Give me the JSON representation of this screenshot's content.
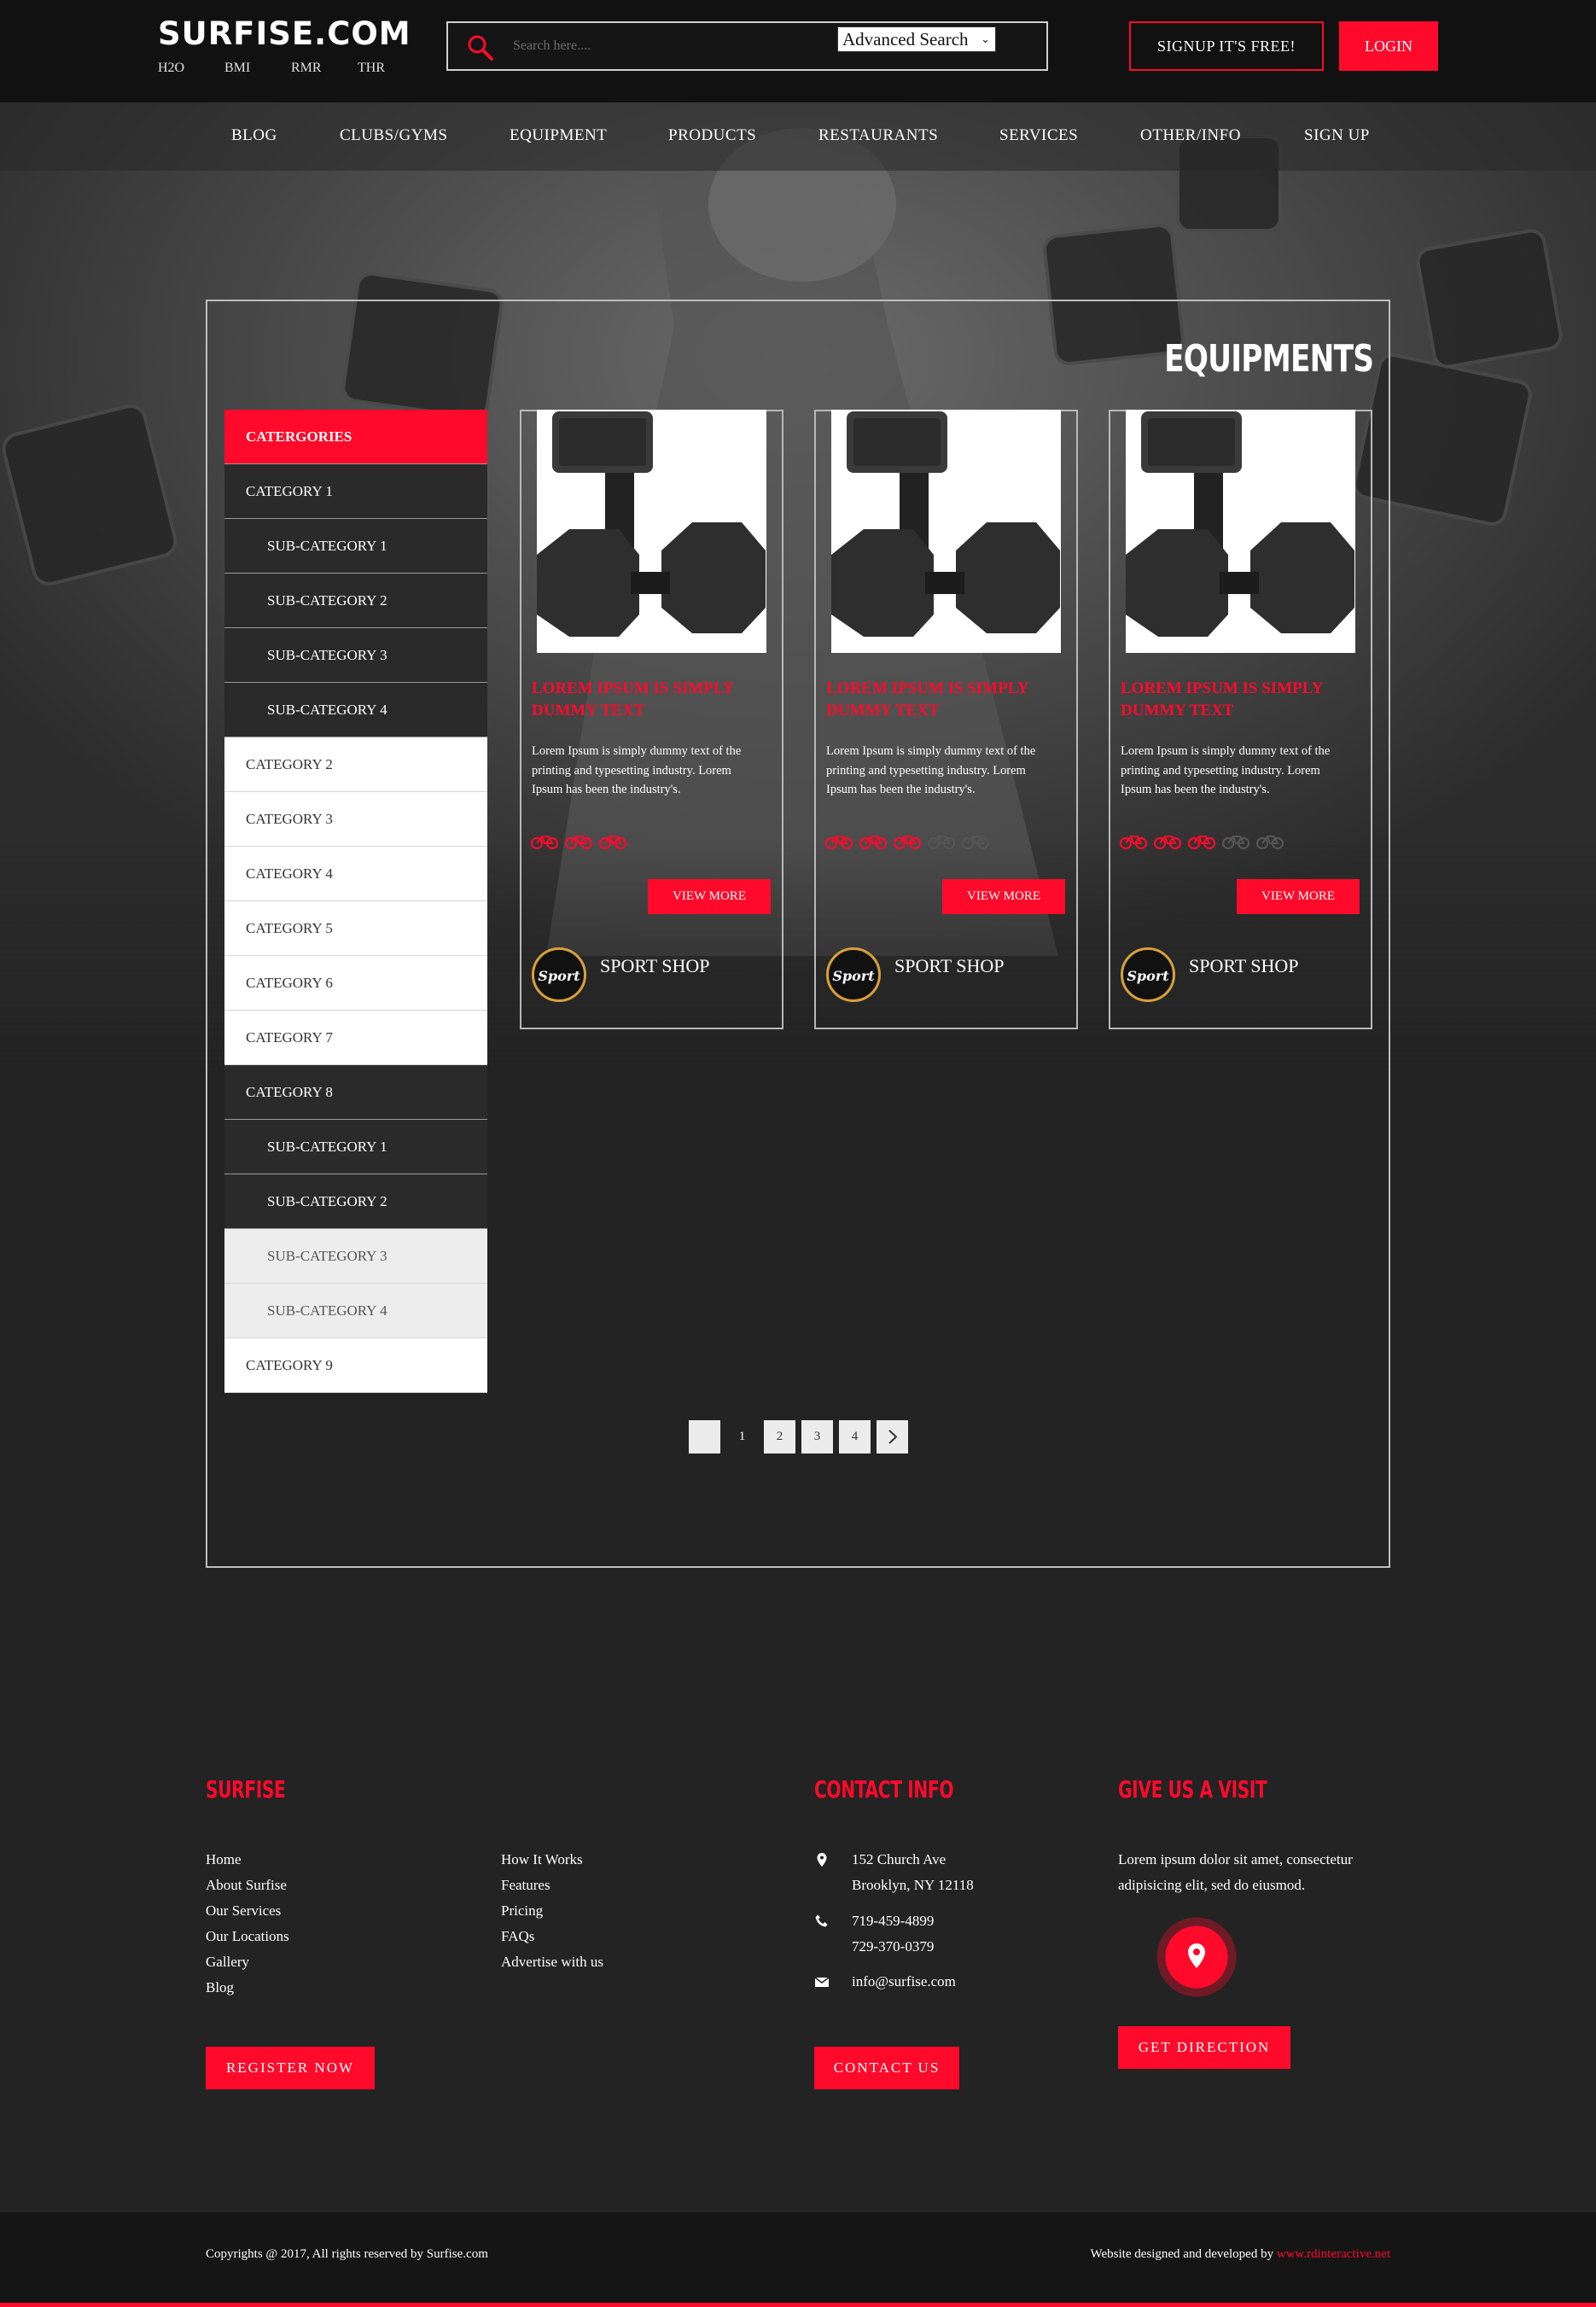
{
  "header": {
    "logo": "SURFISE.COM",
    "logo_links": [
      "H2O",
      "BMI",
      "RMR",
      "THR"
    ],
    "search_placeholder": "Search here....",
    "advanced_search": "Advanced Search",
    "signup": "SIGNUP IT'S FREE!",
    "login": "LOGIN"
  },
  "nav": [
    "BLOG",
    "CLUBS/GYMS",
    "EQUIPMENT",
    "PRODUCTS",
    "RESTAURANTS",
    "SERVICES",
    "OTHER/INFO",
    "SIGN UP"
  ],
  "page_title": "EQUIPMENTS",
  "sidebar": {
    "heading": "CATERGORIES",
    "items": [
      {
        "label": "CATEGORY 1",
        "style": "dark",
        "sub": false
      },
      {
        "label": "SUB-CATEGORY 1",
        "style": "dark",
        "sub": true
      },
      {
        "label": "SUB-CATEGORY 2",
        "style": "dark",
        "sub": true
      },
      {
        "label": "SUB-CATEGORY 3",
        "style": "dark",
        "sub": true
      },
      {
        "label": "SUB-CATEGORY 4",
        "style": "dark",
        "sub": true
      },
      {
        "label": "CATEGORY 2",
        "style": "light",
        "sub": false
      },
      {
        "label": "CATEGORY 3",
        "style": "light",
        "sub": false
      },
      {
        "label": "CATEGORY 4",
        "style": "light",
        "sub": false
      },
      {
        "label": "CATEGORY 5",
        "style": "light",
        "sub": false
      },
      {
        "label": "CATEGORY 6",
        "style": "light",
        "sub": false
      },
      {
        "label": "CATEGORY 7",
        "style": "light",
        "sub": false
      },
      {
        "label": "CATEGORY 8",
        "style": "dark",
        "sub": false
      },
      {
        "label": "SUB-CATEGORY 1",
        "style": "dark",
        "sub": true
      },
      {
        "label": "SUB-CATEGORY 2",
        "style": "dark",
        "sub": true
      },
      {
        "label": "SUB-CATEGORY 3",
        "style": "grey",
        "sub": true
      },
      {
        "label": "SUB-CATEGORY 4",
        "style": "grey",
        "sub": true
      },
      {
        "label": "CATEGORY 9",
        "style": "light",
        "sub": false
      }
    ]
  },
  "products": [
    {
      "title": "LOREM IPSUM IS SIMPLY DUMMY TEXT",
      "desc": "Lorem Ipsum is simply dummy text of the printing and typesetting industry. Lorem Ipsum has been the industry's.",
      "rating": 3,
      "rating_max": 3,
      "button": "VIEW MORE",
      "shop": "SPORT SHOP"
    },
    {
      "title": "LOREM IPSUM IS SIMPLY DUMMY TEXT",
      "desc": "Lorem Ipsum is simply dummy text of the printing and typesetting industry. Lorem Ipsum has been the industry's.",
      "rating": 3,
      "rating_max": 5,
      "button": "VIEW MORE",
      "shop": "SPORT SHOP"
    },
    {
      "title": "LOREM IPSUM IS SIMPLY DUMMY TEXT",
      "desc": "Lorem Ipsum is simply dummy text of the printing and typesetting industry. Lorem Ipsum has been the industry's.",
      "rating": 3,
      "rating_max": 5,
      "button": "VIEW MORE",
      "shop": "SPORT SHOP"
    }
  ],
  "pagination": {
    "pages": [
      "1",
      "2",
      "3",
      "4"
    ],
    "current": "1",
    "next_icon": "chevron-right-icon"
  },
  "footer": {
    "surfise": {
      "heading": "SURFISE",
      "col1": [
        "Home",
        "About Surfise",
        "Our Services",
        "Our Locations",
        "Gallery",
        "Blog"
      ],
      "col2": [
        "How It Works",
        "Features",
        "Pricing",
        "FAQs",
        "Advertise with us"
      ],
      "button": "REGISTER NOW"
    },
    "contact": {
      "heading": "CONTACT INFO",
      "address": [
        "152 Church Ave",
        "Brooklyn, NY 12118"
      ],
      "phones": [
        "719-459-4899",
        "729-370-0379"
      ],
      "email": "info@surfise.com",
      "button": "CONTACT US"
    },
    "visit": {
      "heading": "GIVE US A VISIT",
      "text": "Lorem ipsum dolor sit amet, consectetur adipisicing elit, sed do eiusmod.",
      "button": "GET DIRECTION"
    },
    "copyright": "Copyrights @ 2017, All rights reserved by Surfise.com",
    "credit_prefix": "Website designed and developed by",
    "credit_link": "www.rdinteractive.net"
  },
  "colors": {
    "accent": "#ff0a2b",
    "background": "#232323",
    "topbar": "#111111"
  }
}
